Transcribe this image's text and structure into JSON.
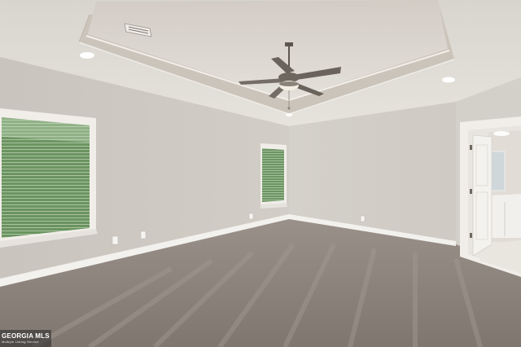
{
  "photo": {
    "subject": "empty bedroom",
    "colors": {
      "wall": "#cdc8c1",
      "ceiling": "#dedad4",
      "trim": "#f4f2ee",
      "carpet": "#8a8078",
      "window_glass": "#5f8a52",
      "tray_shadow": "#c2bab0"
    }
  },
  "watermark": {
    "brand": "GEORGIA MLS",
    "tagline": "Multiple Listing Service"
  }
}
